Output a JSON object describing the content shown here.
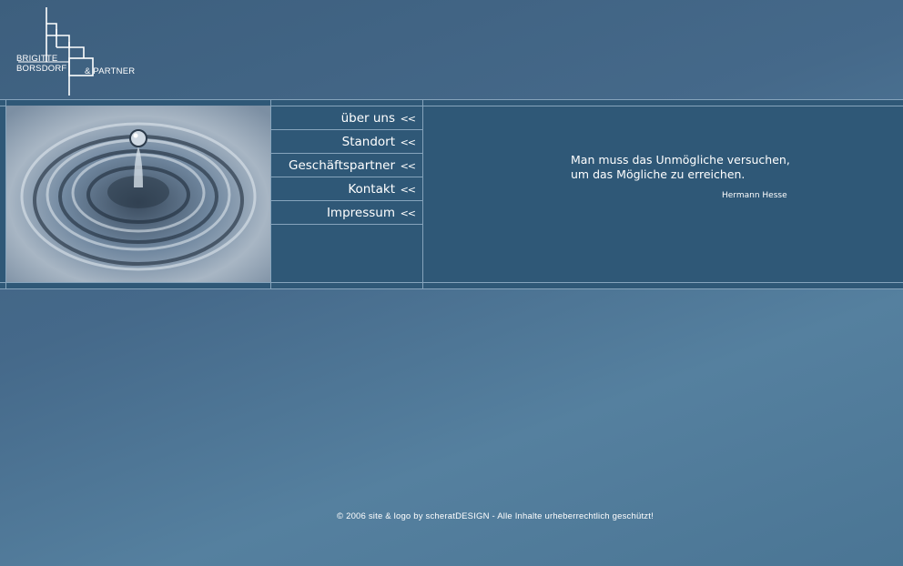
{
  "logo": {
    "line1": "BRIGITTE",
    "line2": "BORSDORF",
    "line3": "& PARTNER"
  },
  "nav": {
    "items": [
      {
        "label": "über uns",
        "arrow": "<<"
      },
      {
        "label": "Standort",
        "arrow": "<<"
      },
      {
        "label": "Geschäftspartner",
        "arrow": "<<"
      },
      {
        "label": "Kontakt",
        "arrow": "<<"
      },
      {
        "label": "Impressum",
        "arrow": "<<"
      }
    ]
  },
  "quote": {
    "line1": "Man muss das Unmögliche versuchen,",
    "line2": "um das Mögliche zu erreichen.",
    "author": "Hermann Hesse"
  },
  "footer": {
    "text": "© 2006 site & logo by scheratDESIGN  -  Alle Inhalte urheberrechtlich geschützt!"
  },
  "colors": {
    "background": "#456a8a",
    "band": "#2f5877",
    "lines": "#86a4bc",
    "text": "#ffffff"
  }
}
